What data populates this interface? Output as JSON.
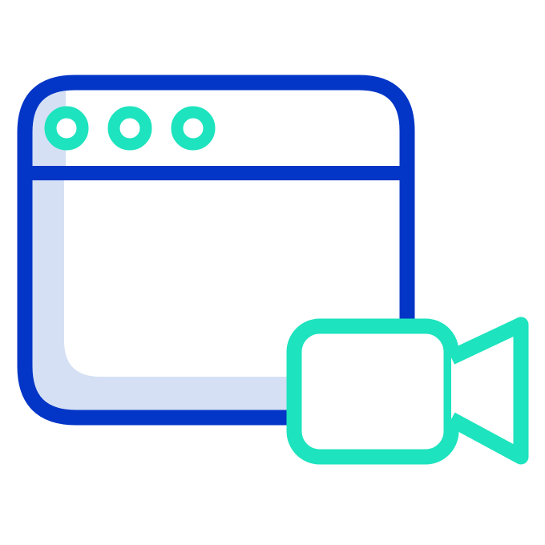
{
  "icon": {
    "name": "browser-video-icon",
    "parts": [
      "browser-window-icon",
      "window-control-dot-icon",
      "video-camera-icon"
    ]
  },
  "colors": {
    "window_stroke": "#0335C7",
    "window_shadow": "#D5E0F4",
    "accent": "#1DE3BE",
    "background": "#FFFFFF"
  }
}
